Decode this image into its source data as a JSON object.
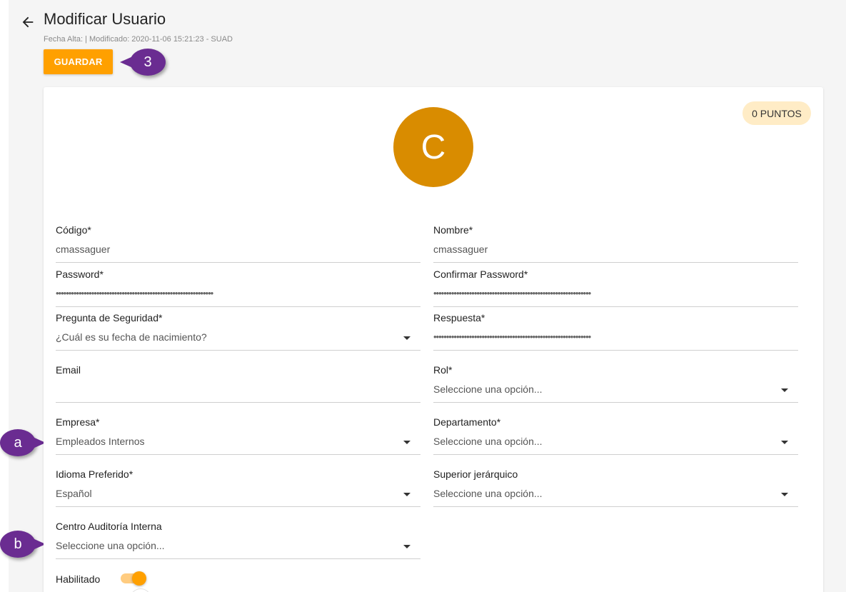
{
  "header": {
    "title": "Modificar Usuario",
    "subtitle": "Fecha Alta: | Modificado: 2020-11-06 15:21:23 - SUAD",
    "save_label": "GUARDAR"
  },
  "callouts": {
    "three": "3",
    "a": "a",
    "b": "b"
  },
  "profile": {
    "points_label": "0 PUNTOS",
    "avatar_initial": "C"
  },
  "form": {
    "codigo": {
      "label": "Código*",
      "value": "cmassaguer"
    },
    "nombre": {
      "label": "Nombre*",
      "value": "cmassaguer"
    },
    "password": {
      "label": "Password*",
      "value": "••••••••••••••••••••••••••••••••••••••••••••••••••••••••••••••"
    },
    "confirmar_password": {
      "label": "Confirmar Password*",
      "value": "••••••••••••••••••••••••••••••••••••••••••••••••••••••••••••••"
    },
    "pregunta_seguridad": {
      "label": "Pregunta de Seguridad*",
      "value": "¿Cuál es su fecha de nacimiento?"
    },
    "respuesta": {
      "label": "Respuesta*",
      "value": "••••••••••••••••••••••••••••••••••••••••••••••••••••••••••••••"
    },
    "email": {
      "label": "Email",
      "value": ""
    },
    "rol": {
      "label": "Rol*",
      "value": "Seleccione una opción..."
    },
    "empresa": {
      "label": "Empresa*",
      "value": "Empleados Internos"
    },
    "departamento": {
      "label": "Departamento*",
      "value": "Seleccione una opción..."
    },
    "idioma": {
      "label": "Idioma Preferido*",
      "value": "Español"
    },
    "superior": {
      "label": "Superior jerárquico",
      "value": "Seleccione una opción..."
    },
    "centro_auditoria": {
      "label": "Centro Auditoría Interna",
      "value": "Seleccione una opción..."
    },
    "habilitado": {
      "label": "Habilitado",
      "enabled": true
    }
  },
  "colors": {
    "accent": "#ffa000",
    "avatar": "#d98c00",
    "callout": "#6a2c91",
    "badge": "#ffecc6"
  }
}
